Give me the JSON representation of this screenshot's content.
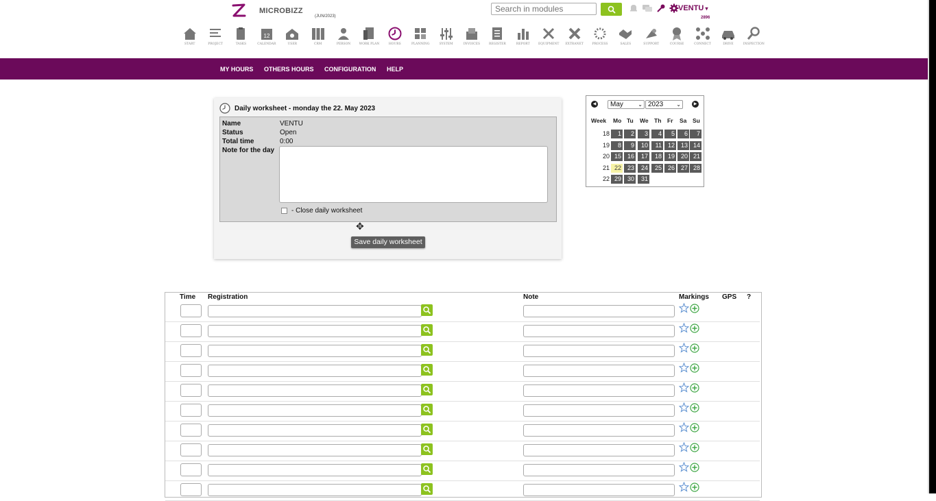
{
  "header": {
    "brand": "MICROBIZZ",
    "version": "(JUN/2023)",
    "search_placeholder": "Search in modules",
    "user": "VENTU",
    "user_number": "2896"
  },
  "modules": [
    {
      "label": "START",
      "icon": "home-icon"
    },
    {
      "label": "PROJECT",
      "icon": "project-icon"
    },
    {
      "label": "TASKS",
      "icon": "clipboard-icon"
    },
    {
      "label": "CALENDAR",
      "icon": "calendar-icon"
    },
    {
      "label": "USER",
      "icon": "user-house-icon"
    },
    {
      "label": "CRM",
      "icon": "crm-grid-icon"
    },
    {
      "label": "PERSON",
      "icon": "person-icon"
    },
    {
      "label": "WORK PLAN",
      "icon": "workplan-icon"
    },
    {
      "label": "HOURS",
      "icon": "clock-icon"
    },
    {
      "label": "PLANNING",
      "icon": "planning-icon"
    },
    {
      "label": "SYSTEM",
      "icon": "sliders-icon"
    },
    {
      "label": "INVOICES",
      "icon": "invoice-icon"
    },
    {
      "label": "REGISTER",
      "icon": "register-icon"
    },
    {
      "label": "REPORT",
      "icon": "bar-chart-icon"
    },
    {
      "label": "EQUIPMENT",
      "icon": "tools-icon"
    },
    {
      "label": "EXTRANET",
      "icon": "x-cross-icon"
    },
    {
      "label": "PROCESS",
      "icon": "spinner-icon"
    },
    {
      "label": "SALES",
      "icon": "handshake-icon"
    },
    {
      "label": "SUPPORT",
      "icon": "support-icon"
    },
    {
      "label": "COURSE",
      "icon": "award-icon"
    },
    {
      "label": "CONNECT",
      "icon": "connect-icon"
    },
    {
      "label": "DRIVE",
      "icon": "car-icon"
    },
    {
      "label": "INSPECTION",
      "icon": "magnifier-icon"
    }
  ],
  "nav": [
    "MY HOURS",
    "OTHERS HOURS",
    "CONFIGURATION",
    "HELP"
  ],
  "worksheet": {
    "title": "Daily worksheet - monday the 22. May 2023",
    "name_label": "Name",
    "name_value": "VENTU",
    "status_label": "Status",
    "status_value": "Open",
    "total_label": "Total time",
    "total_value": "0:00",
    "note_label": "Note for the day",
    "note_value": "",
    "close_label": "- Close daily worksheet",
    "save_label": "Save daily worksheet"
  },
  "calendar": {
    "month": "May",
    "year": "2023",
    "headers": [
      "Week",
      "Mo",
      "Tu",
      "We",
      "Th",
      "Fr",
      "Sa",
      "Su"
    ],
    "weeks": [
      {
        "week": "18",
        "days": [
          "1",
          "2",
          "3",
          "4",
          "5",
          "6",
          "7"
        ]
      },
      {
        "week": "19",
        "days": [
          "8",
          "9",
          "10",
          "11",
          "12",
          "13",
          "14"
        ]
      },
      {
        "week": "20",
        "days": [
          "15",
          "16",
          "17",
          "18",
          "19",
          "20",
          "21"
        ]
      },
      {
        "week": "21",
        "days": [
          "22",
          "23",
          "24",
          "25",
          "26",
          "27",
          "28"
        ]
      },
      {
        "week": "22",
        "days": [
          "29",
          "30",
          "31"
        ]
      }
    ],
    "selected_day": "22"
  },
  "table": {
    "headers": {
      "time": "Time",
      "registration": "Registration",
      "note": "Note",
      "markings": "Markings",
      "gps": "GPS",
      "help": "?"
    },
    "row_count": 10
  },
  "colors": {
    "brand_purple": "#6b0a5a",
    "accent_green": "#8dc21f"
  }
}
